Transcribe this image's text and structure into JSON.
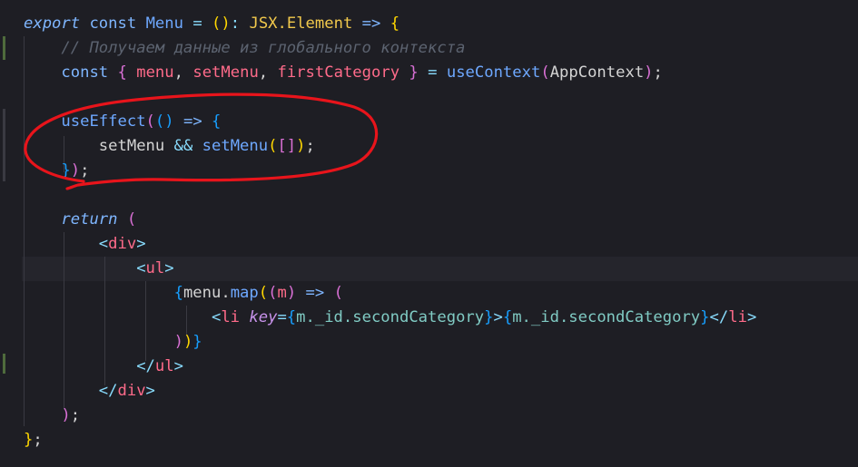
{
  "code": {
    "l1": {
      "kw1": "export",
      "kw2": "const",
      "name": "Menu",
      "eq": "=",
      "paren": "()",
      "colon": ":",
      "type": "JSX.Element",
      "arrow": "=>",
      "brace": "{"
    },
    "l2": {
      "comment": "// Получаем данные из глобального контекста"
    },
    "l3": {
      "kw": "const",
      "ob": "{",
      "v1": "menu",
      "c1": ",",
      "v2": "setMenu",
      "c2": ",",
      "v3": "firstCategory",
      "cb": "}",
      "eq": "=",
      "fn": "useContext",
      "op": "(",
      "arg": "AppContext",
      "cp": ")",
      "semi": ";"
    },
    "l5": {
      "fn": "useEffect",
      "p1": "(",
      "p2": "()",
      "arrow": "=>",
      "brace": "{"
    },
    "l6": {
      "a": "setMenu",
      "and": "&&",
      "fn": "setMenu",
      "p1": "(",
      "br": "[]",
      "p2": ")",
      "semi": ";"
    },
    "l7": {
      "brace": "}",
      "paren": ")",
      "semi": ";"
    },
    "l9": {
      "kw": "return",
      "paren": "("
    },
    "l10": {
      "open": "<",
      "tag": "div",
      "close": ">"
    },
    "l11": {
      "open": "<",
      "tag": "ul",
      "close": ">"
    },
    "l12": {
      "ob": "{",
      "obj": "menu",
      "dot": ".",
      "fn": "map",
      "p1": "(",
      "p2": "(",
      "arg": "m",
      "p3": ")",
      "arrow": "=>",
      "p4": "("
    },
    "l13": {
      "open": "<",
      "tag": "li",
      "attr": "key",
      "eq": "=",
      "ob1": "{",
      "expr1": "m._id.secondCategory",
      "cb1": "}",
      "gt": ">",
      "ob2": "{",
      "expr2": "m._id.secondCategory",
      "cb2": "}",
      "endtag": "</",
      "etag": "li",
      "egt": ">"
    },
    "l14": {
      "p1": ")",
      "p2": ")",
      "cb": "}"
    },
    "l15": {
      "open": "</",
      "tag": "ul",
      "close": ">"
    },
    "l16": {
      "open": "</",
      "tag": "div",
      "close": ">"
    },
    "l17": {
      "paren": ")",
      "semi": ";"
    },
    "l18": {
      "brace": "}",
      "semi": ";"
    }
  },
  "colors": {
    "background": "#1e1e24",
    "annotation_circle": "#e8141b"
  }
}
